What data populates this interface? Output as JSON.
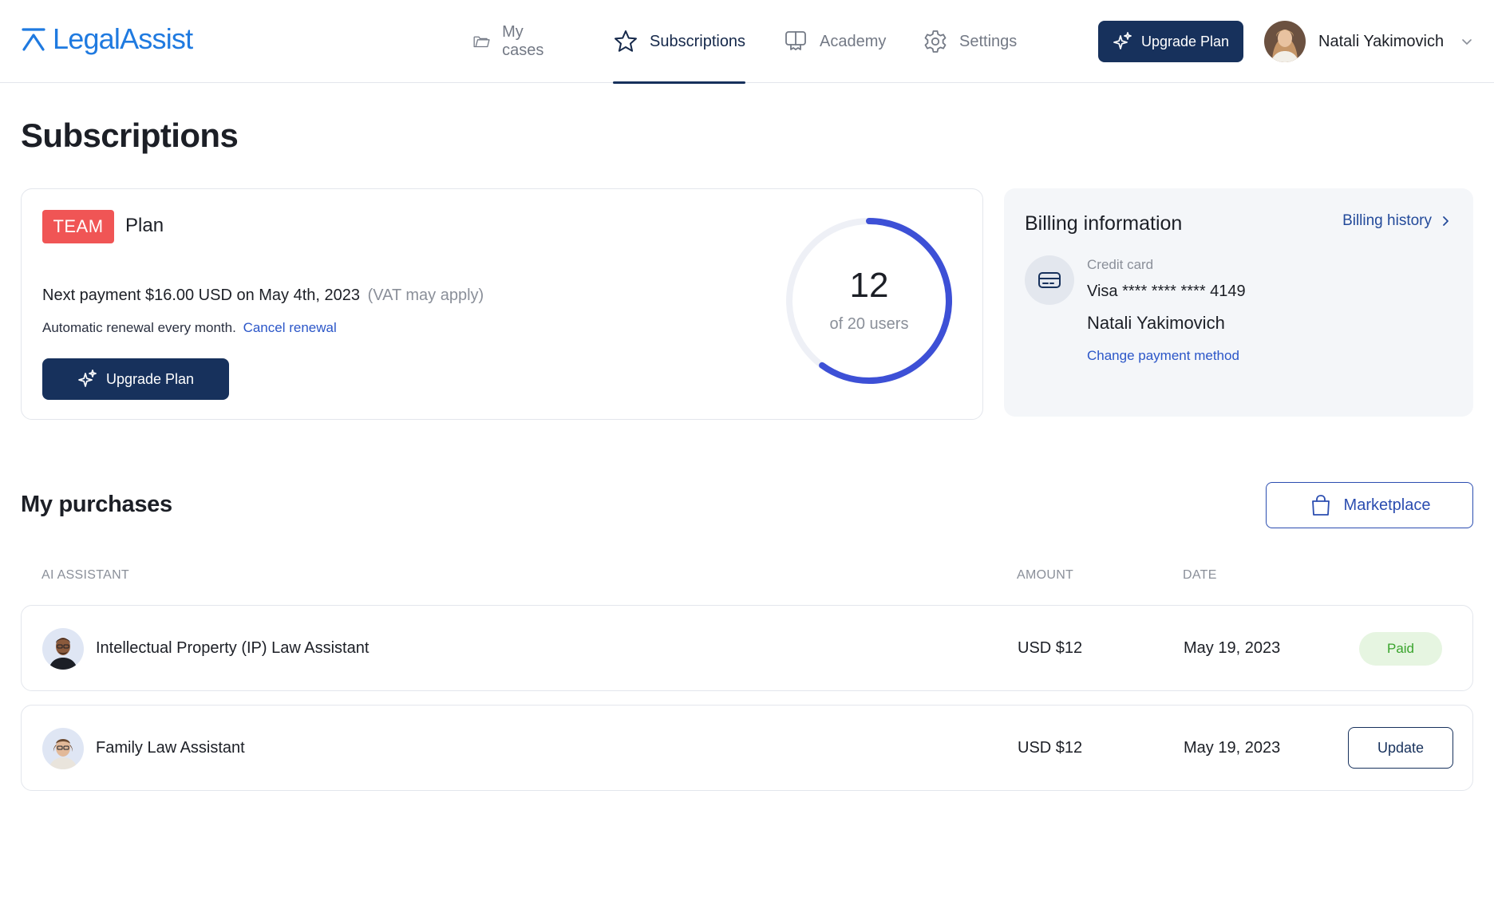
{
  "header": {
    "logo_text": "LegalAssist",
    "nav": [
      {
        "label": "My cases",
        "icon": "folder-icon",
        "active": false
      },
      {
        "label": "Subscriptions",
        "icon": "star-icon",
        "active": true
      },
      {
        "label": "Academy",
        "icon": "academy-icon",
        "active": false
      },
      {
        "label": "Settings",
        "icon": "gear-icon",
        "active": false
      }
    ],
    "upgrade_label": "Upgrade Plan",
    "user_name": "Natali Yakimovich"
  },
  "page": {
    "title": "Subscriptions"
  },
  "plan": {
    "badge": "TEAM",
    "label": "Plan",
    "next_payment": "Next payment $16.00 USD on May 4th, 2023",
    "vat_note": "(VAT may apply)",
    "renewal_text": "Automatic renewal every month.",
    "cancel_label": "Cancel renewal",
    "upgrade_label": "Upgrade Plan",
    "users_used": "12",
    "users_caption": "of 20 users",
    "users_fraction": 0.6
  },
  "billing": {
    "title": "Billing information",
    "history_label": "Billing history",
    "card_label": "Credit card",
    "card_number": "Visa **** **** **** 4149",
    "card_holder": "Natali Yakimovich",
    "change_label": "Change payment method"
  },
  "purchases": {
    "title": "My purchases",
    "marketplace_label": "Marketplace",
    "columns": {
      "assistant": "AI ASSISTANT",
      "amount": "AMOUNT",
      "date": "DATE"
    },
    "rows": [
      {
        "name": "Intellectual Property (IP) Law Assistant",
        "amount": "USD $12",
        "date": "May 19, 2023",
        "status": "Paid"
      },
      {
        "name": "Family Law Assistant",
        "amount": "USD $12",
        "date": "May 19, 2023",
        "action": "Update"
      }
    ]
  },
  "colors": {
    "brand": "#1f7ae0",
    "primary_dark": "#17315c",
    "team_badge": "#f05555",
    "ring_progress": "#3d50d6",
    "ring_track": "#eef0f6",
    "paid_bg": "#e6f5e1",
    "paid_text": "#39a42c"
  }
}
